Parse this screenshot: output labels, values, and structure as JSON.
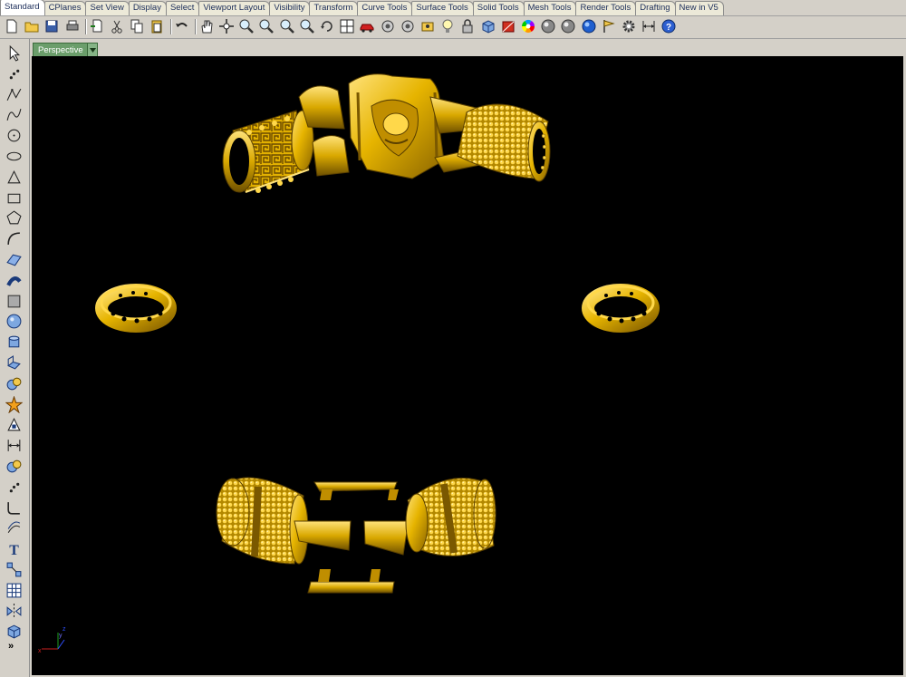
{
  "tabs": [
    "Standard",
    "CPlanes",
    "Set View",
    "Display",
    "Select",
    "Viewport Layout",
    "Visibility",
    "Transform",
    "Curve Tools",
    "Surface Tools",
    "Solid Tools",
    "Mesh Tools",
    "Render Tools",
    "Drafting",
    "New in V5"
  ],
  "active_tab": "Standard",
  "viewport": {
    "label": "Perspective"
  },
  "axis": {
    "x": "x",
    "y": "y",
    "z": "z"
  },
  "colors": {
    "gold": "#e6b800",
    "gold_dark": "#7a5a00",
    "viewport_bg": "#000000",
    "chrome": "#d4d0c8",
    "viewport_label_bg": "#6b9e6b"
  },
  "toolbar_icons": [
    "new-file-icon",
    "open-folder-icon",
    "save-icon",
    "print-icon",
    "import-icon",
    "cut-icon",
    "copy-icon",
    "paste-icon",
    "undo-icon",
    "pan-hand-icon",
    "move-icon",
    "zoom-icon",
    "zoom-window-icon",
    "zoom-extents-icon",
    "zoom-selected-icon",
    "rotate-view-icon",
    "four-viewports-icon",
    "car-icon",
    "camera-icon",
    "lens-icon",
    "named-views-icon",
    "light-bulb-icon",
    "lock-icon",
    "box-icon",
    "shade-icon",
    "color-wheel-icon",
    "render-sphere-icon",
    "render-sphere-alt-icon",
    "globe-icon",
    "flag-icon",
    "gear-icon",
    "dimension-icon",
    "help-icon"
  ],
  "left_tools": [
    "select-arrow-icon",
    "point-icon",
    "polyline-icon",
    "curve-icon",
    "circle-icon",
    "ellipse-icon",
    "triangle-icon",
    "rectangle-icon",
    "polygon-icon",
    "arc-icon",
    "surface-icon",
    "sweep-icon",
    "box-solid-icon",
    "sphere-solid-icon",
    "cylinder-solid-icon",
    "extrude-icon",
    "boolean-icon",
    "explode-icon",
    "transform-icon",
    "dimension-tool-icon",
    "boolean-union-icon",
    "points-icon",
    "fillet-icon",
    "offset-icon",
    "text-icon",
    "array-icon",
    "grid-icon",
    "mirror-icon",
    "solid-box-icon"
  ]
}
